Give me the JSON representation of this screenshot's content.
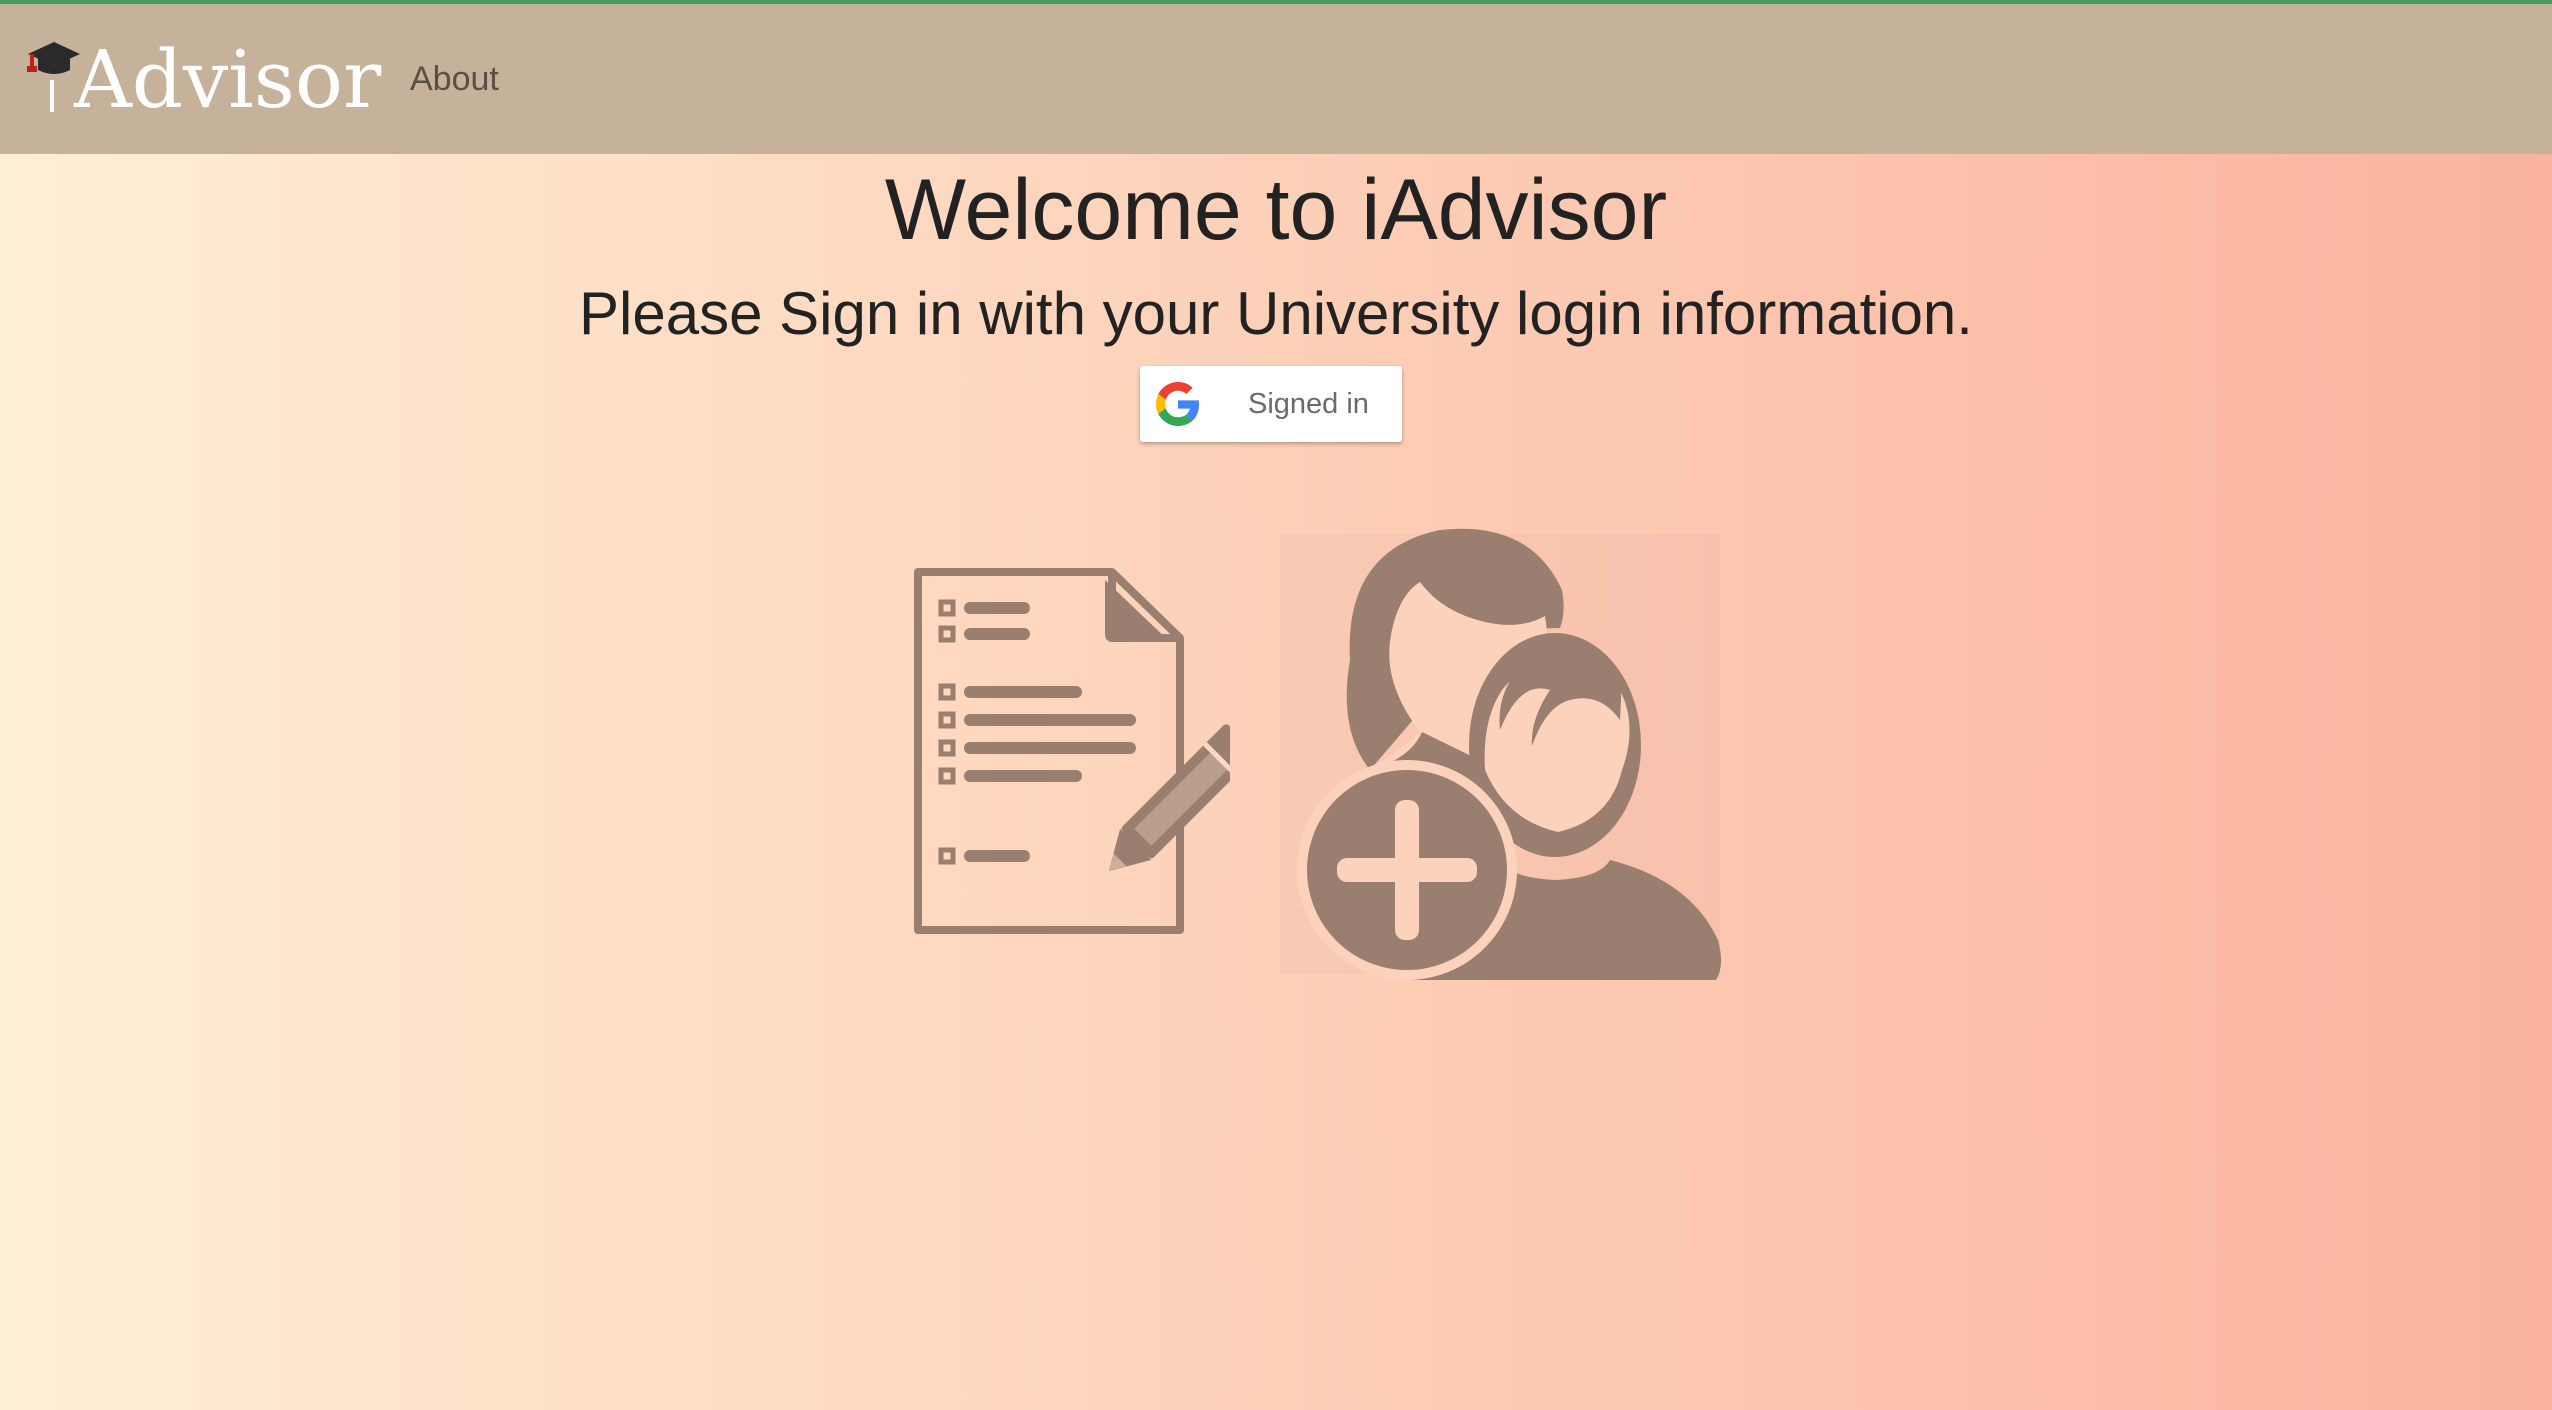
{
  "navbar": {
    "brand_text": "Advisor",
    "brand_icon": "graduation-cap-icon",
    "about_label": "About",
    "background": "#c6b29b"
  },
  "main": {
    "title": "Welcome to iAdvisor",
    "subtitle": "Please Sign in with your University login information.",
    "signin_button": {
      "label": "Signed in",
      "icon": "google-icon"
    },
    "illustration": {
      "left_icon": "document-checklist-pencil-icon",
      "right_icon": "add-users-icon",
      "icon_color": "#9a7e70"
    }
  },
  "colors": {
    "gradient_start": "#ffeed6",
    "gradient_end": "#fbb39f",
    "accent_line": "#4a9a5c"
  }
}
